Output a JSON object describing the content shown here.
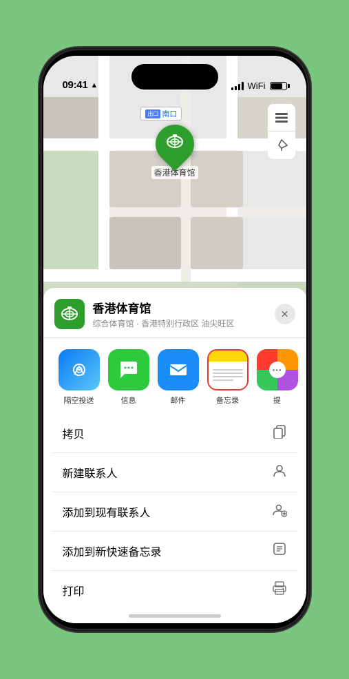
{
  "statusBar": {
    "time": "09:41",
    "arrow": "▶"
  },
  "mapLabels": {
    "nankou": "南口",
    "nankou_prefix": "出口"
  },
  "stadium": {
    "name": "香港体育馆",
    "icon": "🏟",
    "pin_emoji": "🏟"
  },
  "mapControls": {
    "layers": "🗺",
    "location": "➤"
  },
  "bottomSheet": {
    "venueName": "香港体育馆",
    "venueDesc": "综合体育馆 · 香港特别行政区 油尖旺区",
    "closeLabel": "✕"
  },
  "shareItems": [
    {
      "id": "airdrop",
      "label": "隔空投送",
      "icon": "📡",
      "colorClass": "share-icon-airdrop"
    },
    {
      "id": "message",
      "label": "信息",
      "icon": "💬",
      "colorClass": "share-icon-message"
    },
    {
      "id": "mail",
      "label": "邮件",
      "icon": "✉",
      "colorClass": "share-icon-mail"
    },
    {
      "id": "notes",
      "label": "备忘录",
      "icon": "📝",
      "colorClass": "share-icon-notes"
    },
    {
      "id": "more",
      "label": "提",
      "icon": "•••",
      "colorClass": "share-icon-more"
    }
  ],
  "actionItems": [
    {
      "id": "copy",
      "label": "拷贝",
      "icon": "⎘"
    },
    {
      "id": "new-contact",
      "label": "新建联系人",
      "icon": "👤"
    },
    {
      "id": "add-existing",
      "label": "添加到现有联系人",
      "icon": "👤+"
    },
    {
      "id": "add-notes",
      "label": "添加到新快速备忘录",
      "icon": "⊡"
    },
    {
      "id": "print",
      "label": "打印",
      "icon": "🖨"
    }
  ],
  "colors": {
    "accent_green": "#2d9e2d",
    "accent_blue": "#1a6ef5",
    "notes_yellow": "#ffd60a",
    "notes_border": "#e53935"
  }
}
